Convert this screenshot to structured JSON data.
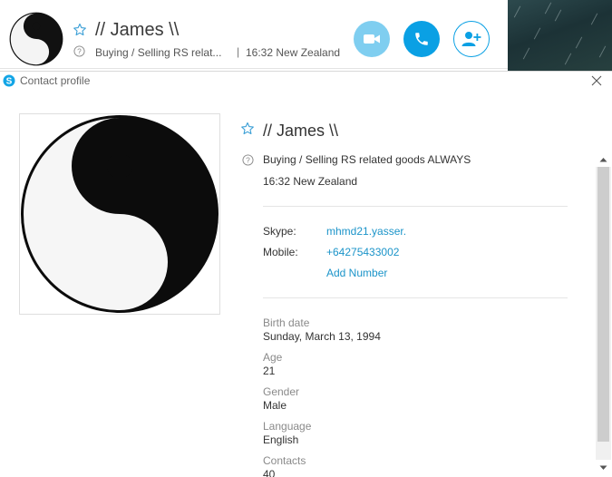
{
  "header": {
    "name": "// James \\\\",
    "mood_truncated": "Buying / Selling RS relat...",
    "separator": "|",
    "local_time": "16:32 New Zealand",
    "buttons": {
      "video": "video-call-icon",
      "call": "phone-icon",
      "add": "add-contact-icon"
    },
    "colors": {
      "video": "#7fcef0",
      "call": "#0aa0e4"
    }
  },
  "dialog": {
    "title": "Contact profile",
    "name": "// James \\\\",
    "mood": "Buying / Selling RS related goods ALWAYS",
    "local_time": "16:32 New Zealand",
    "skype_label": "Skype:",
    "skype_value": "mhmd21.yasser.",
    "mobile_label": "Mobile:",
    "mobile_value": "+64275433002",
    "add_number": "Add Number",
    "details": [
      {
        "label": "Birth date",
        "value": "Sunday, March 13, 1994"
      },
      {
        "label": "Age",
        "value": "21"
      },
      {
        "label": "Gender",
        "value": "Male"
      },
      {
        "label": "Language",
        "value": "English"
      },
      {
        "label": "Contacts",
        "value": "40"
      }
    ],
    "link_color": "#1b94c9"
  }
}
